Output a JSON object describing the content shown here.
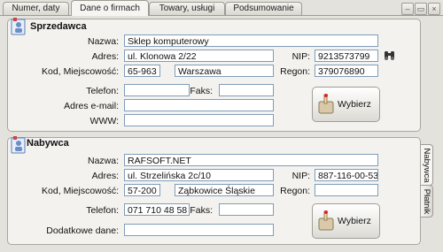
{
  "tabs": [
    {
      "label": "Numer, daty"
    },
    {
      "label": "Dane o firmach"
    },
    {
      "label": "Towary, usługi"
    },
    {
      "label": "Podsumowanie"
    }
  ],
  "seller": {
    "title": "Sprzedawca",
    "name_label": "Nazwa:",
    "name_value": "Sklep komputerowy",
    "address_label": "Adres:",
    "address_value": "ul. Klonowa 2/22",
    "nip_label": "NIP:",
    "nip_value": "9213573799",
    "city_label": "Kod, Miejscowość:",
    "postal_value": "65-963",
    "city_value": "Warszawa",
    "regon_label": "Regon:",
    "regon_value": "379076890",
    "phone_label": "Telefon:",
    "phone_value": "",
    "fax_label": "Faks:",
    "fax_value": "",
    "email_label": "Adres e-mail:",
    "email_value": "",
    "www_label": "WWW:",
    "www_value": "",
    "choose_label": "Wybierz"
  },
  "buyer": {
    "title": "Nabywca",
    "name_label": "Nazwa:",
    "name_value": "RAFSOFT.NET",
    "address_label": "Adres:",
    "address_value": "ul. Strzelińska 2c/10",
    "nip_label": "NIP:",
    "nip_value": "887-116-00-53",
    "city_label": "Kod, Miejscowość:",
    "postal_value": "57-200",
    "city_value": "Ząbkowice Śląskie",
    "regon_label": "Regon:",
    "regon_value": "",
    "phone_label": "Telefon:",
    "phone_value": "071 710 48 58",
    "fax_label": "Faks:",
    "fax_value": "",
    "extra_label": "Dodatkowe dane:",
    "extra_value": "",
    "choose_label": "Wybierz"
  },
  "side_tabs": [
    {
      "label": "Nabywca"
    },
    {
      "label": "Płatnik"
    }
  ],
  "icons": {
    "binoculars": "binoculars-icon",
    "seller": "contact-card-icon",
    "buyer": "contact-card-icon",
    "choose": "hand-pointer-icon"
  }
}
